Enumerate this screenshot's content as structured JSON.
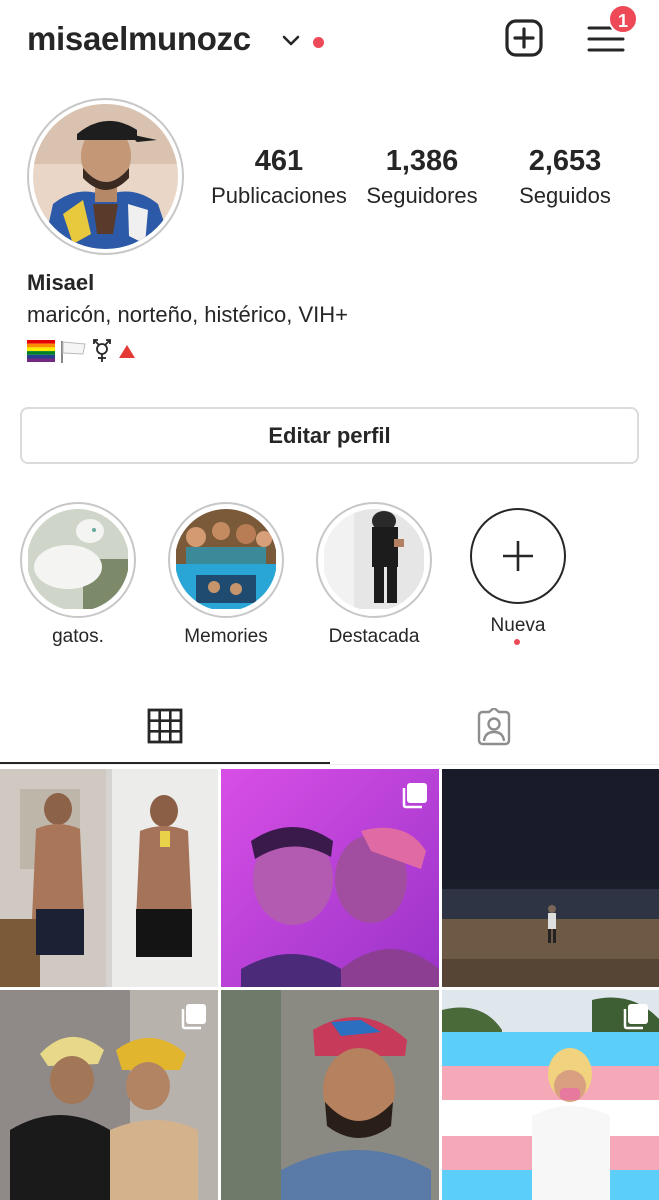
{
  "header": {
    "username": "misaelmunozc",
    "notification_count": "1"
  },
  "stats": [
    {
      "value": "461",
      "label": "Publicaciones"
    },
    {
      "value": "1,386",
      "label": "Seguidores"
    },
    {
      "value": "2,653",
      "label": "Seguidos"
    }
  ],
  "bio": {
    "name": "Misael",
    "text": "maricón, norteño, histérico, VIH+"
  },
  "edit_profile_label": "Editar perfil",
  "highlights": [
    {
      "label": "gatos."
    },
    {
      "label": "Memories"
    },
    {
      "label": "Destacada"
    },
    {
      "label": "Nueva"
    }
  ],
  "icons": {
    "chevron": "chevron-down-icon",
    "new_post": "plus-square-icon",
    "menu": "hamburger-menu-icon",
    "grid_tab": "grid-icon",
    "tagged_tab": "tagged-person-icon",
    "multi_photo": "carousel-icon"
  },
  "colors": {
    "accent_red": "#ed4956",
    "text": "#262626",
    "border": "#dbdbdb"
  }
}
